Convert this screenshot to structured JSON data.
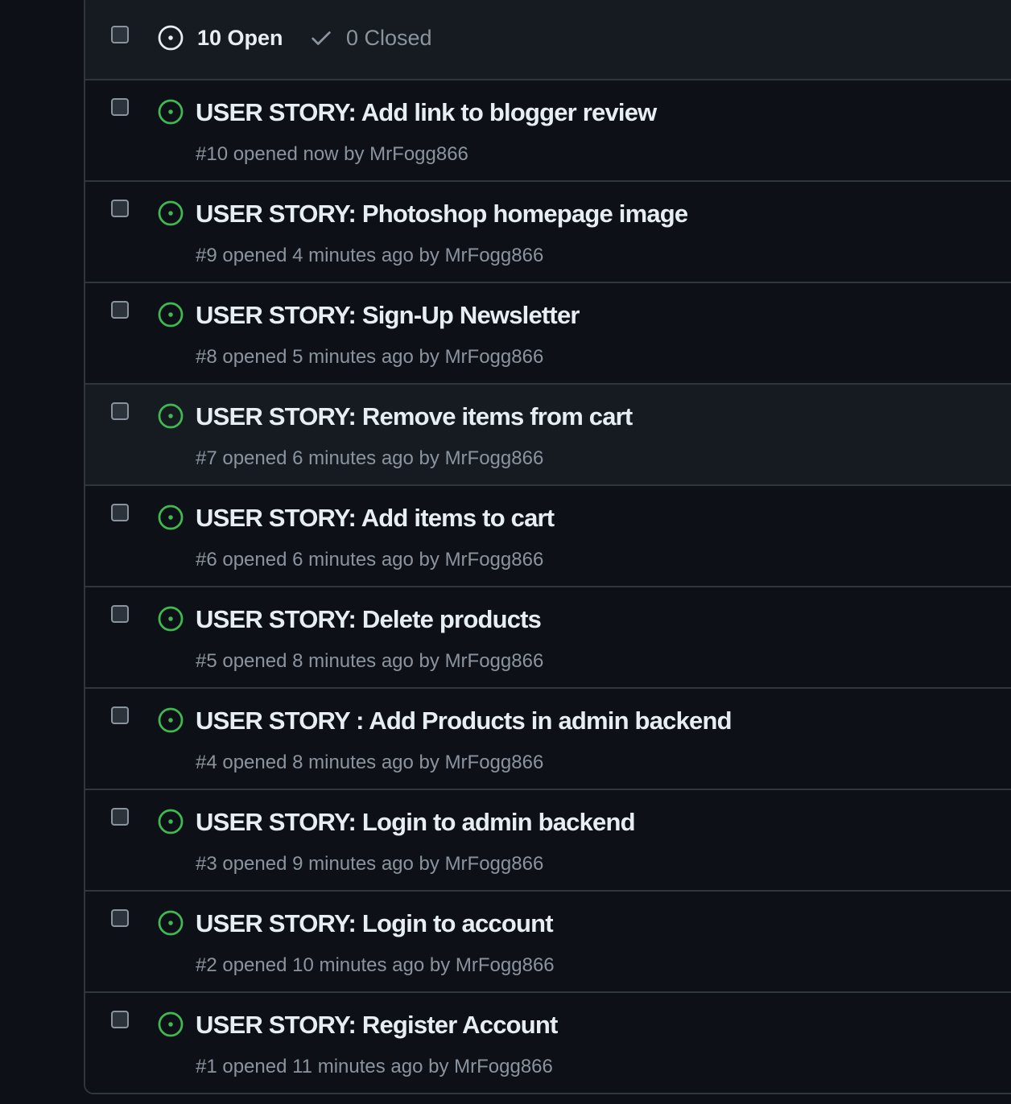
{
  "header": {
    "open_label": "10 Open",
    "closed_label": "0 Closed"
  },
  "colors": {
    "open_icon": "#3fb950",
    "title": "#e6edf3",
    "meta": "#8b949e",
    "border": "#30363d"
  },
  "issues": [
    {
      "title": "USER STORY: Add link to blogger review",
      "meta": "#10 opened now by MrFogg866"
    },
    {
      "title": "USER STORY: Photoshop homepage image",
      "meta": "#9 opened 4 minutes ago by MrFogg866"
    },
    {
      "title": "USER STORY: Sign-Up Newsletter",
      "meta": "#8 opened 5 minutes ago by MrFogg866"
    },
    {
      "title": "USER STORY: Remove items from cart",
      "meta": "#7 opened 6 minutes ago by MrFogg866"
    },
    {
      "title": "USER STORY: Add items to cart",
      "meta": "#6 opened 6 minutes ago by MrFogg866"
    },
    {
      "title": "USER STORY: Delete products",
      "meta": "#5 opened 8 minutes ago by MrFogg866"
    },
    {
      "title": "USER STORY : Add Products in admin backend",
      "meta": "#4 opened 8 minutes ago by MrFogg866"
    },
    {
      "title": "USER STORY: Login to admin backend",
      "meta": "#3 opened 9 minutes ago by MrFogg866"
    },
    {
      "title": "USER STORY: Login to account",
      "meta": "#2 opened 10 minutes ago by MrFogg866"
    },
    {
      "title": "USER STORY: Register Account",
      "meta": "#1 opened 11 minutes ago by MrFogg866"
    }
  ]
}
